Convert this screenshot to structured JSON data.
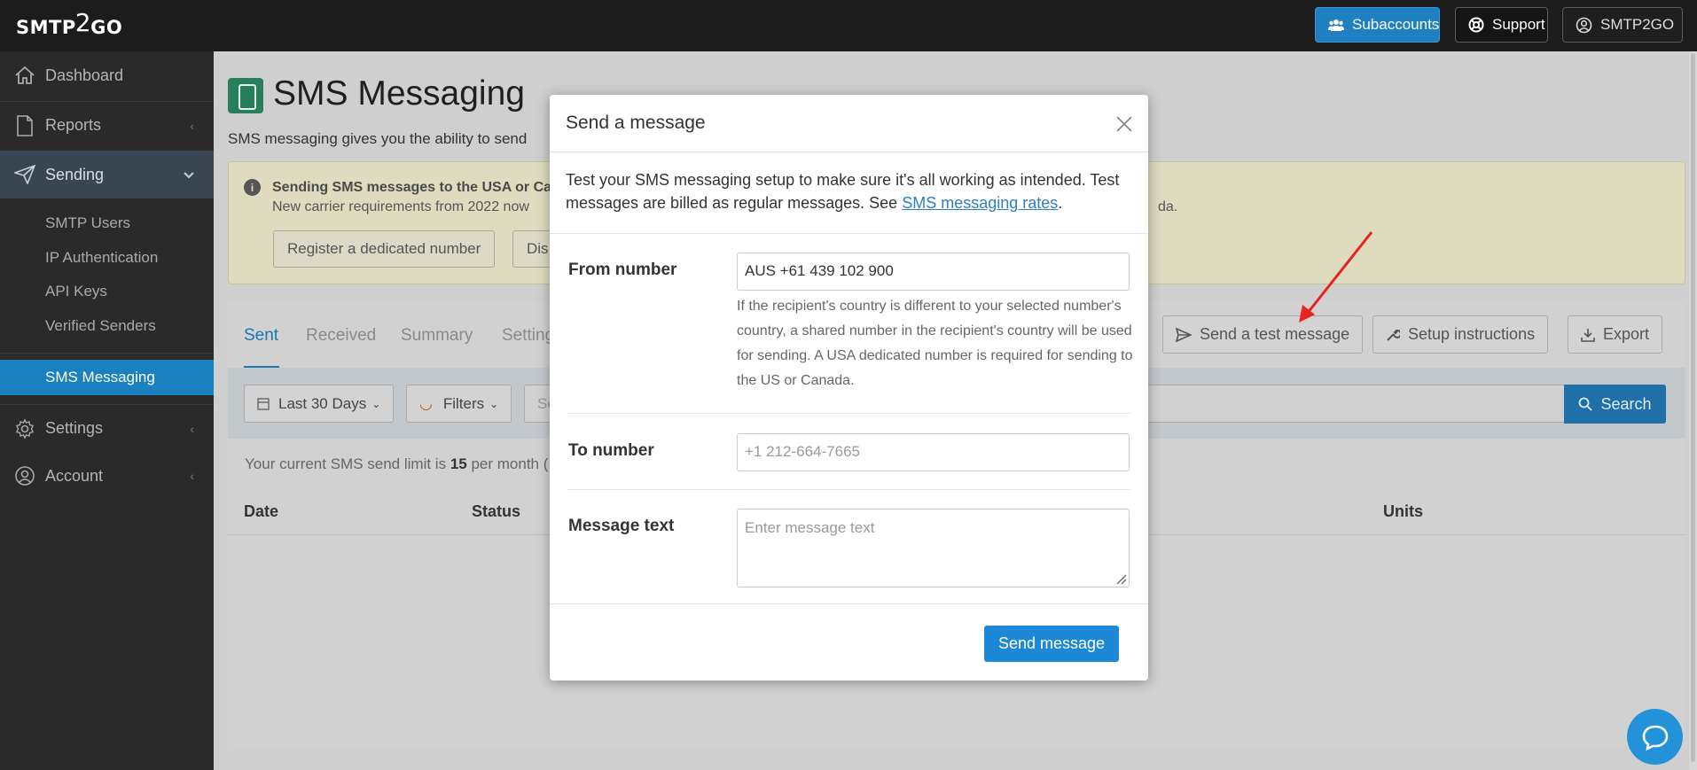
{
  "app": {
    "logo_text_a": "SMTP",
    "logo_text_b": "2",
    "logo_text_c": "GO"
  },
  "topbar": {
    "subaccounts": "Subaccounts",
    "support": "Support",
    "account": "SMTP2GO"
  },
  "sidebar": {
    "dashboard": "Dashboard",
    "reports": "Reports",
    "sending": "Sending",
    "sub_items": [
      "SMTP Users",
      "IP Authentication",
      "API Keys",
      "Verified Senders"
    ],
    "sms": "SMS Messaging",
    "settings": "Settings",
    "account": "Account"
  },
  "page": {
    "title": "SMS Messaging",
    "subtitle": "SMS messaging gives you the ability to send",
    "notice_title": "Sending SMS messages to the USA or Ca",
    "notice_text": "New carrier requirements from 2022 now",
    "notice_text_tail": "da.",
    "notice_btn_register": "Register a dedicated number",
    "notice_btn_dis": "Dis",
    "tabs": [
      "Sent",
      "Received",
      "Summary",
      "Setting"
    ],
    "btn_test": "Send a test message",
    "btn_setup": "Setup instructions",
    "btn_export": "Export",
    "filter_range": "Last 30 Days",
    "filter_filters": "Filters",
    "search_placeholder": "Se",
    "search_btn": "Search",
    "limit_pre": "Your current SMS send limit is",
    "limit_value": "15",
    "limit_post": "per month (",
    "col_date": "Date",
    "col_status": "Status",
    "col_units": "Units"
  },
  "modal": {
    "title": "Send a message",
    "desc_pre": "Test your SMS messaging setup to make sure it's all working as intended. Test messages are billed as regular messages. See",
    "desc_link": "SMS messaging rates",
    "desc_post": ".",
    "from_label": "From number",
    "from_value": "AUS +61 439 102 900",
    "from_help": "If the recipient's country is different to your selected number's country, a shared number in the recipient's country will be used for sending. A USA dedicated number is required for sending to the US or Canada.",
    "to_label": "To number",
    "to_placeholder": "+1 212-664-7665",
    "text_label": "Message text",
    "text_placeholder": "Enter message text",
    "send_btn": "Send message"
  },
  "colors": {
    "accent": "#1e88d8",
    "topbar": "#1c1c1c",
    "sidebar": "#2a2a2a",
    "arrow": "#e8231d"
  },
  "icons": [
    "users-icon",
    "lifebuoy-icon",
    "user-circle-icon",
    "home-icon",
    "document-icon",
    "paper-plane-icon",
    "gear-icon",
    "user-icon",
    "info-icon",
    "calendar-icon",
    "search-icon",
    "wrench-icon",
    "download-icon",
    "close-icon",
    "chat-icon"
  ]
}
